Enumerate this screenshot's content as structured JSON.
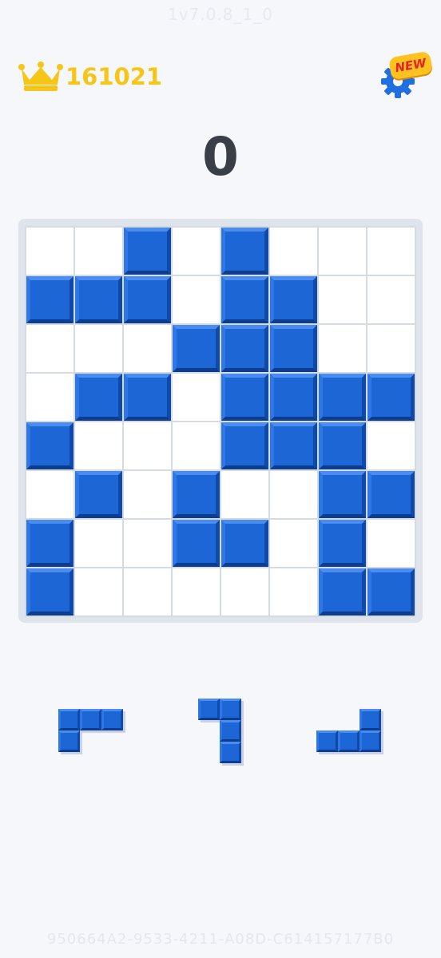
{
  "header": {
    "version_label": "1v7.0.8_1_0",
    "best_score": "161021",
    "best_icon": "crown-icon",
    "settings_icon": "gear-icon",
    "settings_badge": "NEW"
  },
  "game": {
    "score": "0",
    "board_size": 8,
    "board_rows": [
      [
        0,
        0,
        1,
        0,
        1,
        0,
        0,
        0
      ],
      [
        1,
        1,
        1,
        0,
        1,
        1,
        0,
        0
      ],
      [
        0,
        0,
        0,
        1,
        1,
        1,
        0,
        0
      ],
      [
        0,
        1,
        1,
        0,
        1,
        1,
        1,
        1
      ],
      [
        1,
        0,
        0,
        0,
        1,
        1,
        1,
        0
      ],
      [
        0,
        1,
        0,
        1,
        0,
        0,
        1,
        1
      ],
      [
        1,
        0,
        0,
        1,
        1,
        0,
        1,
        0
      ],
      [
        1,
        0,
        0,
        0,
        0,
        0,
        1,
        1
      ]
    ],
    "pieces": [
      [
        [
          1,
          1,
          1
        ],
        [
          1,
          0,
          0
        ]
      ],
      [
        [
          1,
          1
        ],
        [
          0,
          1
        ],
        [
          0,
          1
        ]
      ],
      [
        [
          0,
          0,
          1
        ],
        [
          1,
          1,
          1
        ]
      ]
    ]
  },
  "footer": {
    "device_id": "950664A2-9533-4211-A08D-C614157177B0"
  },
  "colors": {
    "block": "#1d66d6",
    "best_score": "#f5c518",
    "score": "#3a3e47",
    "background": "#f5f7fb",
    "badge": "#ffc21f",
    "badge_text": "#e5212a",
    "gear": "#1f6fe0"
  }
}
